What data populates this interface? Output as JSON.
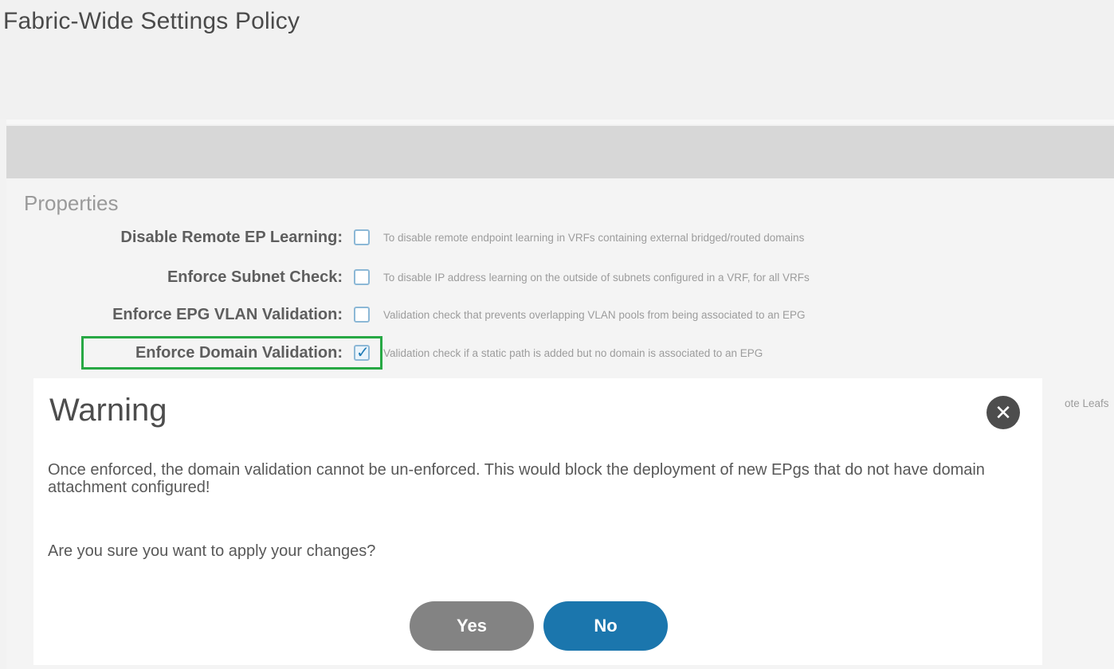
{
  "header": {
    "title": "Fabric-Wide Settings Policy"
  },
  "properties": {
    "heading": "Properties",
    "rows": [
      {
        "label": "Disable Remote EP Learning:",
        "checked": false,
        "description": "To disable remote endpoint learning in VRFs containing external bridged/routed domains"
      },
      {
        "label": "Enforce Subnet Check:",
        "checked": false,
        "description": "To disable IP address learning on the outside of subnets configured in a VRF, for all VRFs"
      },
      {
        "label": "Enforce EPG VLAN Validation:",
        "checked": false,
        "description": "Validation check that prevents overlapping VLAN pools from being associated to an EPG"
      },
      {
        "label": "Enforce Domain Validation:",
        "checked": true,
        "description": "Validation check if a static path is added but no domain is associated to an EPG"
      }
    ],
    "overflow_text": "ote Leafs"
  },
  "modal": {
    "title": "Warning",
    "message": "Once enforced, the domain validation cannot be un-enforced. This would block the deployment of new EPgs that do not have domain attachment configured!",
    "question": "Are you sure you want to apply your changes?",
    "yes_label": "Yes",
    "no_label": "No",
    "close_icon": "✕"
  },
  "colors": {
    "highlight": "#27a844",
    "primary_button": "#1b76ad",
    "secondary_button": "#838383",
    "checkbox_border": "#8cb8d6"
  }
}
